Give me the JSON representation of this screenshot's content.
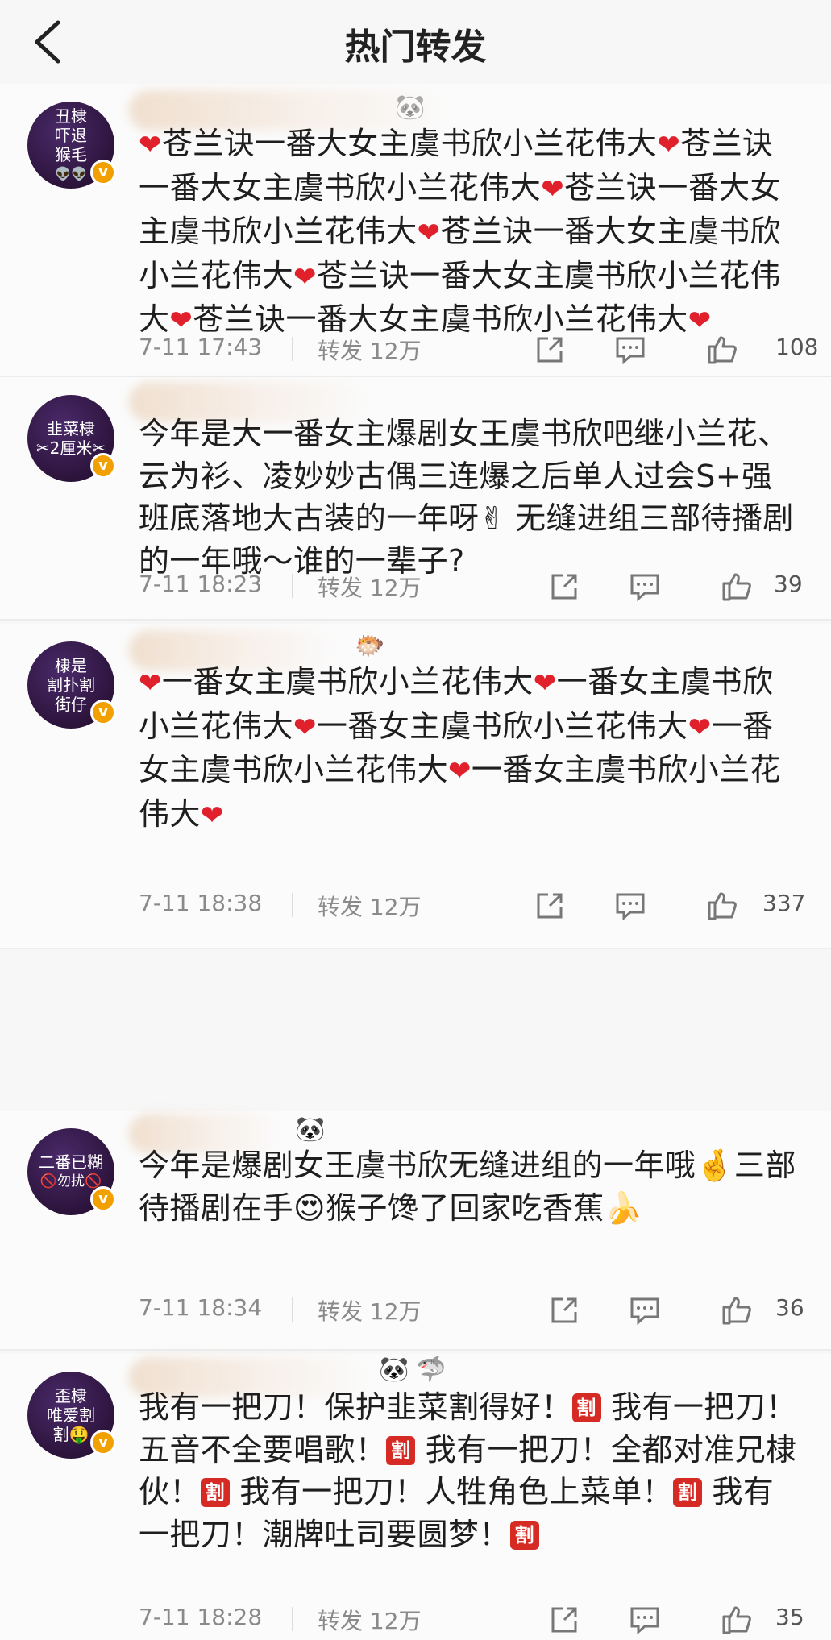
{
  "header": {
    "title": "热门转发"
  },
  "posts": [
    {
      "avatar_lines": [
        "丑棣",
        "吓退",
        "猴毛",
        "👽👽"
      ],
      "text": "❤苍兰诀一番大女主虞书欣小兰花伟大❤苍兰诀一番大女主虞书欣小兰花伟大❤苍兰诀一番大女主虞书欣小兰花伟大❤苍兰诀一番大女主虞书欣小兰花伟大❤苍兰诀一番大女主虞书欣小兰花伟大❤苍兰诀一番大女主虞书欣小兰花伟大❤",
      "time": "7-11 17:43",
      "forward": "转发 12万",
      "likes": "108"
    },
    {
      "avatar_lines": [
        "韭菜棣",
        "✂2厘米✂"
      ],
      "text": "今年是大一番女主爆剧女王虞书欣吧继小兰花、云为衫、凌妙妙古偶三连爆之后单人过会S+强班底落地大古装的一年呀✌ 无缝进组三部待播剧的一年哦～谁的一辈子?",
      "time": "7-11 18:23",
      "forward": "转发 12万",
      "likes": "39"
    },
    {
      "avatar_lines": [
        "棣是",
        "割扑割",
        "街仔"
      ],
      "text": "❤一番女主虞书欣小兰花伟大❤一番女主虞书欣小兰花伟大❤一番女主虞书欣小兰花伟大❤一番女主虞书欣小兰花伟大❤一番女主虞书欣小兰花伟大❤",
      "time": "7-11 18:38",
      "forward": "转发 12万",
      "likes": "337"
    },
    {
      "avatar_lines": [
        "二番已糊",
        "🚫勿扰🚫"
      ],
      "text": "今年是爆剧女王虞书欣无缝进组的一年哦🤞三部待播剧在手😍猴子馋了回家吃香蕉🍌",
      "time": "7-11 18:34",
      "forward": "转发 12万",
      "likes": "36"
    },
    {
      "avatar_lines": [
        "歪棣",
        "唯爱割",
        "割🤑"
      ],
      "text": "我有一把刀！保护韭菜割得好！割 我有一把刀！五音不全要唱歌！割 我有一把刀！全都对准兄棣伙！割 我有一把刀！人牲角色上菜单！割 我有一把刀！潮牌吐司要圆梦！割",
      "time": "7-11 18:28",
      "forward": "转发 12万",
      "likes": "35"
    }
  ],
  "icons": [
    "back-arrow-icon",
    "share-icon",
    "comment-icon",
    "like-icon"
  ],
  "colors": {
    "heart": "#e0202a",
    "cut_badge": "#d62b25",
    "verified": "#f2a000",
    "meta": "#8a8a8a"
  }
}
